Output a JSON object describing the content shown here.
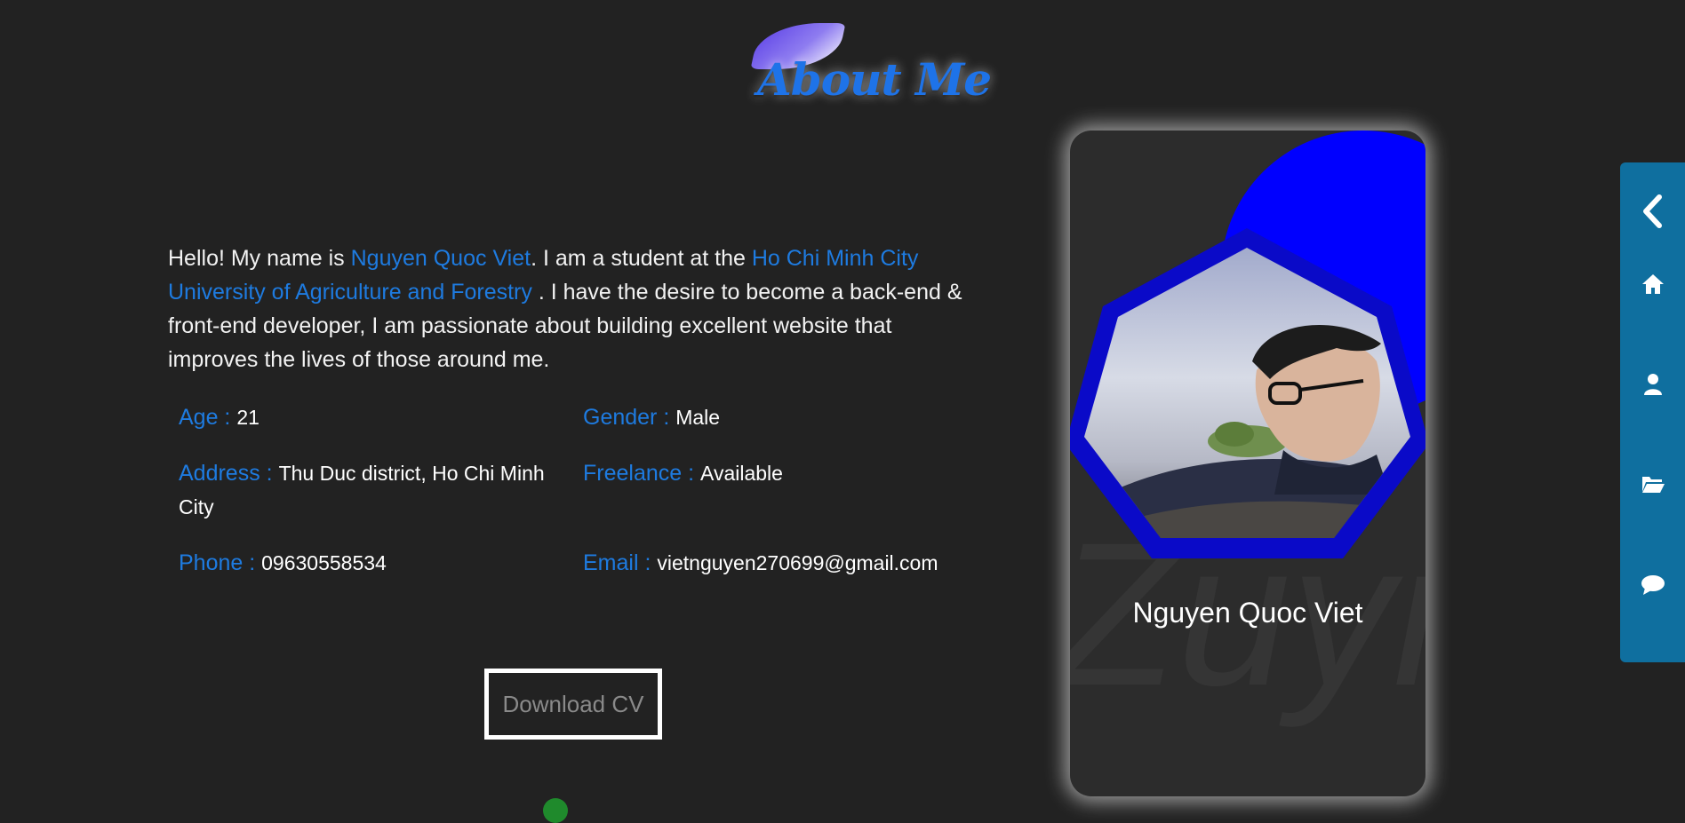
{
  "heading": {
    "title": "About Me"
  },
  "bio": {
    "intro": "Hello! My name is ",
    "name": "Nguyen Quoc Viet",
    "mid": ". I am a student at the ",
    "university": "Ho Chi Minh City University of Agriculture and Forestry",
    "rest": " . I have the desire to become a back-end & front-end developer, I am passionate about building excellent website that improves the lives of those around me."
  },
  "info": {
    "age_label": "Age : ",
    "age_value": "21",
    "gender_label": "Gender : ",
    "gender_value": "Male",
    "address_label": "Address : ",
    "address_value": "Thu Duc district, Ho Chi Minh City",
    "freelance_label": "Freelance : ",
    "freelance_value": "Available",
    "phone_label": "Phone : ",
    "phone_value": "09630558534",
    "email_label": "Email : ",
    "email_value": "vietnguyen270699@gmail.com"
  },
  "download_label": "Download CV",
  "card": {
    "name": "Nguyen Quoc Viet",
    "watermark": "Zuyr"
  },
  "sidenav": {
    "items": [
      "chevron-left-icon",
      "home-icon",
      "user-icon",
      "folder-open-icon",
      "comment-icon"
    ]
  },
  "colors": {
    "background": "#222222",
    "accent": "#1e7be0",
    "sidenav": "#0f6f9f",
    "card_circle": "#0000ff",
    "hex_frame": "#0a0ac8"
  }
}
